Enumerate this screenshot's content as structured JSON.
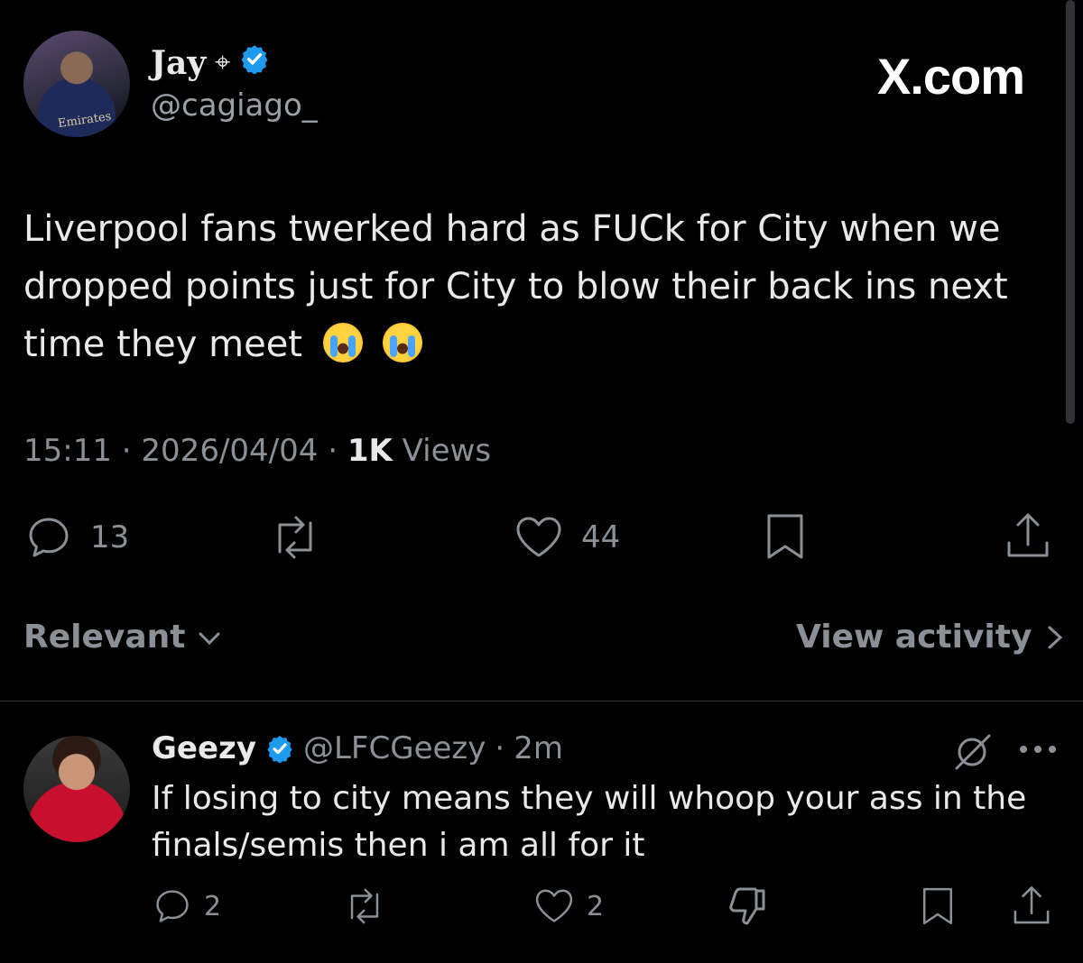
{
  "header": {
    "display_name": "Jay",
    "name_emoji": "⌖",
    "handle": "@cagiago_",
    "site_label": "X.com",
    "avatar_shirt_text": "Emirates"
  },
  "tweet": {
    "text_line1": "Liverpool fans twerked hard as FUCk for City when we",
    "text_line2": "dropped points just for City to blow their back ins next",
    "text_line3": "time they meet",
    "time": "15:11",
    "date": "2026/04/04",
    "views_count": "1K",
    "views_label": "Views",
    "actions": {
      "reply_count": "13",
      "like_count": "44"
    }
  },
  "sort": {
    "relevant_label": "Relevant",
    "view_activity_label": "View activity"
  },
  "reply": {
    "name": "Geezy",
    "handle": "@LFCGeezy",
    "age": "2m",
    "text_line1": "If losing to city means they will whoop your ass in the",
    "text_line2": "finals/semis then i am all for it",
    "reply_count": "2",
    "like_count": "2"
  },
  "icons": {
    "verified": "verified-badge-icon",
    "reply": "speech-bubble-icon",
    "repost": "repost-icon",
    "like": "heart-icon",
    "bookmark": "bookmark-icon",
    "share": "share-icon",
    "grok": "grok-icon",
    "more": "more-icon",
    "downvote": "thumbs-down-icon"
  },
  "colors": {
    "background": "#000000",
    "text": "#e7e9ea",
    "muted": "#8b9096",
    "verified": "#1d9bf0"
  }
}
